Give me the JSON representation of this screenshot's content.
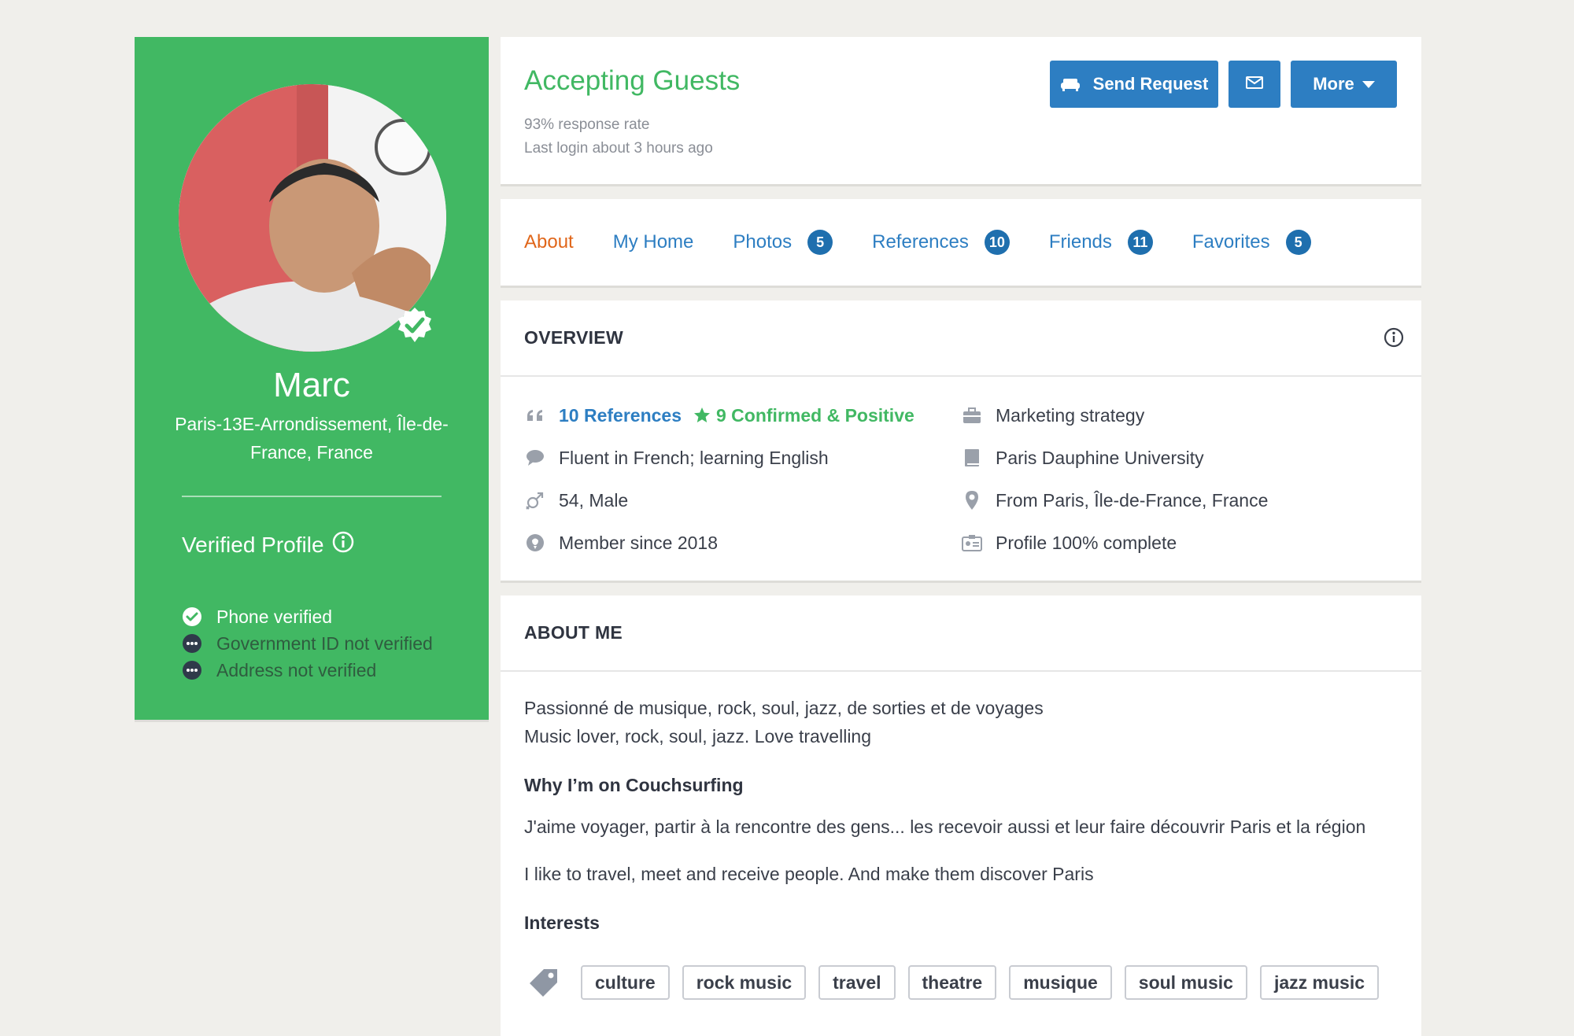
{
  "profile": {
    "name": "Marc",
    "location": "Paris-13E-Arrondissement, Île-de-France, France",
    "verified_title": "Verified Profile",
    "verifications": [
      {
        "label": "Phone verified",
        "status": "verified"
      },
      {
        "label": "Government ID not verified",
        "status": "not-verified"
      },
      {
        "label": "Address not verified",
        "status": "not-verified"
      }
    ]
  },
  "status": {
    "title": "Accepting Guests",
    "response_rate": "93% response rate",
    "last_login": "Last login about 3 hours ago"
  },
  "actions": {
    "send_request": "Send Request",
    "more": "More"
  },
  "tabs": [
    {
      "label": "About",
      "active": true
    },
    {
      "label": "My Home"
    },
    {
      "label": "Photos",
      "count": "5"
    },
    {
      "label": "References",
      "count": "10"
    },
    {
      "label": "Friends",
      "count": "11"
    },
    {
      "label": "Favorites",
      "count": "5"
    }
  ],
  "overview": {
    "heading": "OVERVIEW",
    "references": "10 References",
    "confirmed": "9 Confirmed & Positive",
    "languages": "Fluent in French; learning English",
    "age_gender": "54, Male",
    "member_since": "Member since 2018",
    "occupation": "Marketing strategy",
    "education": "Paris Dauphine University",
    "hometown": "From Paris, Île-de-France, France",
    "completeness": "Profile 100% complete"
  },
  "about": {
    "heading": "ABOUT ME",
    "line1": "Passionné de musique, rock, soul, jazz, de sorties et de voyages",
    "line2": "Music lover, rock, soul, jazz. Love travelling",
    "why_heading": "Why I’m on Couchsurfing",
    "why_fr": "J'aime voyager, partir à la rencontre des gens... les recevoir aussi et leur faire découvrir Paris et la région",
    "why_en": "I like to travel, meet and receive people. And make them discover Paris",
    "interests_heading": "Interests",
    "interests": [
      "culture",
      "rock music",
      "travel",
      "theatre",
      "musique",
      "soul music",
      "jazz music"
    ]
  },
  "colors": {
    "brand_green": "#41b863",
    "link_blue": "#2d7ec2",
    "active_tab": "#e0661a"
  }
}
